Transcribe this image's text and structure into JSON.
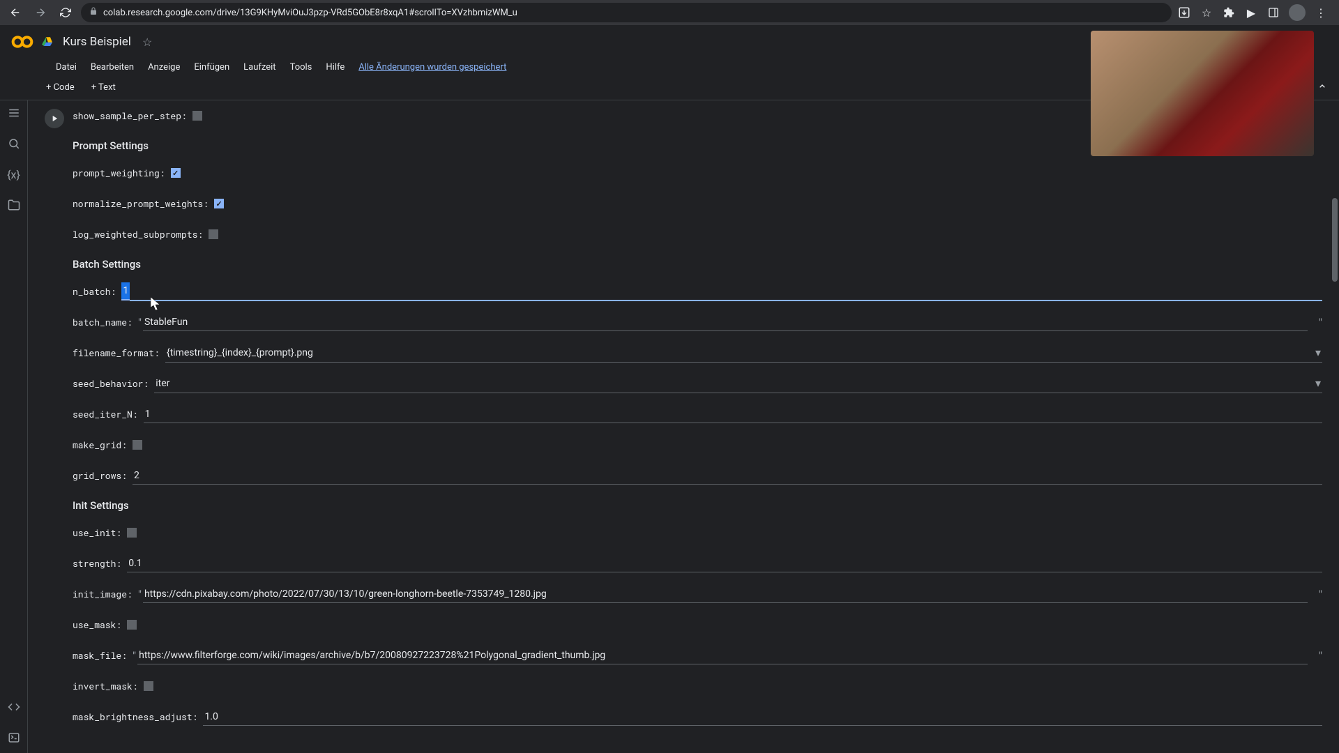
{
  "browser": {
    "url": "colab.research.google.com/drive/13G9KHyMviOuJ3pzp-VRd5GObE8r8xqA1#scrollTo=XVzhbmizWM_u"
  },
  "header": {
    "title": "Kurs Beispiel"
  },
  "menu": {
    "items": [
      "Datei",
      "Bearbeiten",
      "Anzeige",
      "Einfügen",
      "Laufzeit",
      "Tools",
      "Hilfe"
    ],
    "save_status": "Alle Änderungen wurden gespeichert"
  },
  "toolbar": {
    "code": "+ Code",
    "text": "+ Text"
  },
  "form": {
    "show_sample_per_step": {
      "label": "show_sample_per_step:",
      "checked": false
    },
    "section_prompt": "Prompt Settings",
    "prompt_weighting": {
      "label": "prompt_weighting:",
      "checked": true
    },
    "normalize_prompt_weights": {
      "label": "normalize_prompt_weights:",
      "checked": true
    },
    "log_weighted_subprompts": {
      "label": "log_weighted_subprompts:",
      "checked": false
    },
    "section_batch": "Batch Settings",
    "n_batch": {
      "label": "n_batch:",
      "value": "1"
    },
    "batch_name": {
      "label": "batch_name:",
      "value": "StableFun"
    },
    "filename_format": {
      "label": "filename_format:",
      "value": "{timestring}_{index}_{prompt}.png"
    },
    "seed_behavior": {
      "label": "seed_behavior:",
      "value": "iter"
    },
    "seed_iter_N": {
      "label": "seed_iter_N:",
      "value": "1"
    },
    "make_grid": {
      "label": "make_grid:",
      "checked": false
    },
    "grid_rows": {
      "label": "grid_rows:",
      "value": "2"
    },
    "section_init": "Init Settings",
    "use_init": {
      "label": "use_init:",
      "checked": false
    },
    "strength": {
      "label": "strength:",
      "value": "0.1"
    },
    "init_image": {
      "label": "init_image:",
      "value": "https://cdn.pixabay.com/photo/2022/07/30/13/10/green-longhorn-beetle-7353749_1280.jpg"
    },
    "use_mask": {
      "label": "use_mask:",
      "checked": false
    },
    "mask_file": {
      "label": "mask_file:",
      "value": "https://www.filterforge.com/wiki/images/archive/b/b7/20080927223728%21Polygonal_gradient_thumb.jpg"
    },
    "invert_mask": {
      "label": "invert_mask:",
      "checked": false
    },
    "mask_brightness_adjust": {
      "label": "mask_brightness_adjust:",
      "value": "1.0"
    }
  }
}
